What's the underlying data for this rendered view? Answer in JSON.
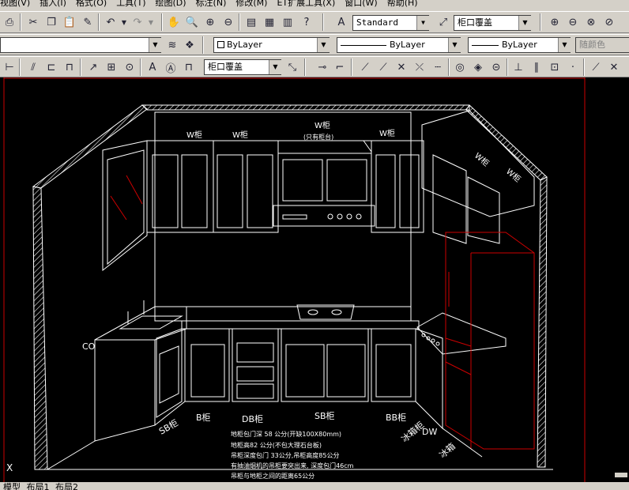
{
  "menu": [
    "视图(V)",
    "插入(I)",
    "格式(O)",
    "工具(T)",
    "绘图(D)",
    "标注(N)",
    "修改(M)",
    "ET扩展工具(X)",
    "窗口(W)",
    "帮助(H)"
  ],
  "toolbar1": {
    "text_style": "Standard",
    "dim_style": "柜口覆盖"
  },
  "toolbar2": {
    "layer": "",
    "color": "ByLayer",
    "linetype": "ByLayer",
    "lineweight": "ByLayer",
    "plot_style": "随颜色"
  },
  "toolbar3": {
    "dim_style2": "柜口覆盖"
  },
  "drawing": {
    "labels": {
      "w_left": "W柜",
      "w_mid": "W柜",
      "w_hood": "W柜",
      "hood_note": "(只有柜台)",
      "w_right": "W柜",
      "w_side1": "W柜",
      "w_side2": "W柜",
      "co": "CO",
      "sb_left": "SB柜",
      "b": "B柜",
      "db": "DB柜",
      "sb_mid": "SB柜",
      "bb": "BB柜",
      "dw": "DW",
      "fridge_cab": "冰箱柜",
      "fridge": "冰箱",
      "x_mark": "X"
    },
    "notes": [
      "地柜包门深 58 公分(开缺100X80mm)",
      "地柜高82 公分(不包大理石台板)",
      "吊柜深度包门 33公分,吊柜高度85公分",
      "有抽油烟机的吊柜要突出来, 深度包门46cm",
      "吊柜与地柜之间的距离65公分"
    ]
  },
  "tabs": [
    "模型",
    "布局1",
    "布局2"
  ]
}
